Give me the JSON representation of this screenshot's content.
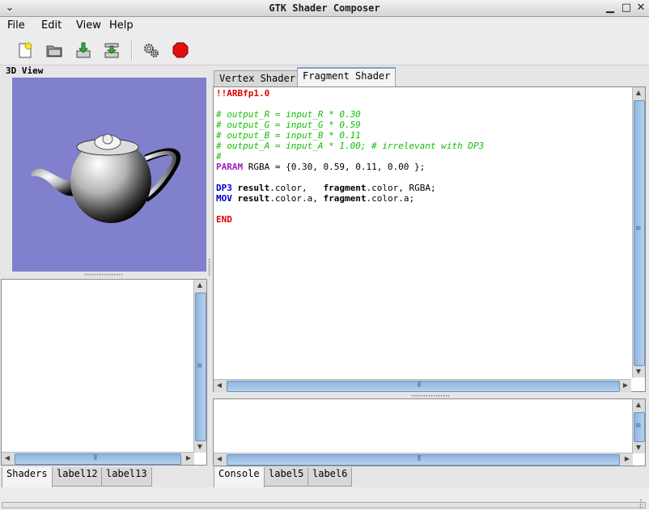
{
  "window": {
    "title": "GTK Shader Composer"
  },
  "menubar": {
    "items": [
      "File",
      "Edit",
      "View",
      "Help"
    ]
  },
  "toolbar": {
    "icons": [
      "new-icon",
      "open-icon",
      "save-icon",
      "export-icon",
      "settings-icon",
      "stop-icon"
    ]
  },
  "left": {
    "view_label": "3D View",
    "viewport_bg": "#8080cc",
    "bottom_tabs": [
      "Shaders",
      "label12",
      "label13"
    ]
  },
  "editor": {
    "tabs": [
      "Vertex Shader",
      "Fragment Shader"
    ],
    "active_tab": "Fragment Shader",
    "lines": [
      [
        {
          "t": "!!ARBfp1.0",
          "c": "red"
        }
      ],
      [],
      [
        {
          "t": "# output_R = input_R * 0.30",
          "c": "green"
        }
      ],
      [
        {
          "t": "# output_G = input_G * 0.59",
          "c": "green"
        }
      ],
      [
        {
          "t": "# output_B = input_B * 0.11",
          "c": "green"
        }
      ],
      [
        {
          "t": "# output_A = input_A * 1.00; # irrelevant with DP3",
          "c": "green"
        }
      ],
      [
        {
          "t": "#",
          "c": "green"
        }
      ],
      [
        {
          "t": "PARAM",
          "c": "purple"
        },
        {
          "t": " RGBA = {0.30, 0.59, 0.11, 0.00 };",
          "c": ""
        }
      ],
      [],
      [
        {
          "t": "DP3",
          "c": "blue"
        },
        {
          "t": " ",
          "c": ""
        },
        {
          "t": "result",
          "c": "bold"
        },
        {
          "t": ".color,   ",
          "c": ""
        },
        {
          "t": "fragment",
          "c": "bold"
        },
        {
          "t": ".color, RGBA;",
          "c": ""
        }
      ],
      [
        {
          "t": "MOV",
          "c": "blue"
        },
        {
          "t": " ",
          "c": ""
        },
        {
          "t": "result",
          "c": "bold"
        },
        {
          "t": ".color.a, ",
          "c": ""
        },
        {
          "t": "fragment",
          "c": "bold"
        },
        {
          "t": ".color.a;",
          "c": ""
        }
      ],
      [],
      [
        {
          "t": "END",
          "c": "red"
        }
      ]
    ]
  },
  "console": {
    "bottom_tabs": [
      "Console",
      "label5",
      "label6"
    ]
  }
}
